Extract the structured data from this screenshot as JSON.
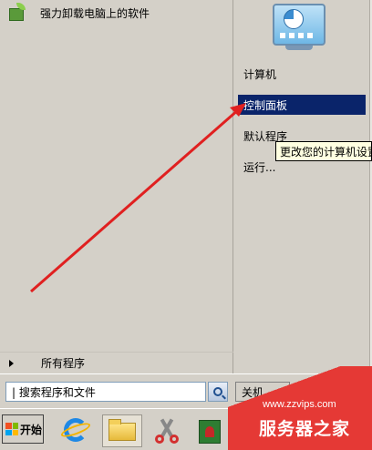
{
  "start_menu": {
    "left": {
      "recent_item_label": "强力卸载电脑上的软件",
      "all_programs_label": "所有程序"
    },
    "right": {
      "items": [
        {
          "label": "计算机"
        },
        {
          "label": "控制面板"
        },
        {
          "label": "默认程序"
        },
        {
          "label": "运行..."
        }
      ]
    },
    "tooltip": "更改您的计算机设置",
    "search": {
      "value": "| 搜索程序和文件"
    },
    "shutdown_label": "关机"
  },
  "taskbar": {
    "start_label": "开始"
  },
  "watermark": {
    "url": "www.zzvips.com",
    "brand": "服务器之家"
  },
  "colors": {
    "highlight": "#0a246a",
    "annotation_arrow": "#e02020",
    "watermark_red": "#e53935"
  }
}
